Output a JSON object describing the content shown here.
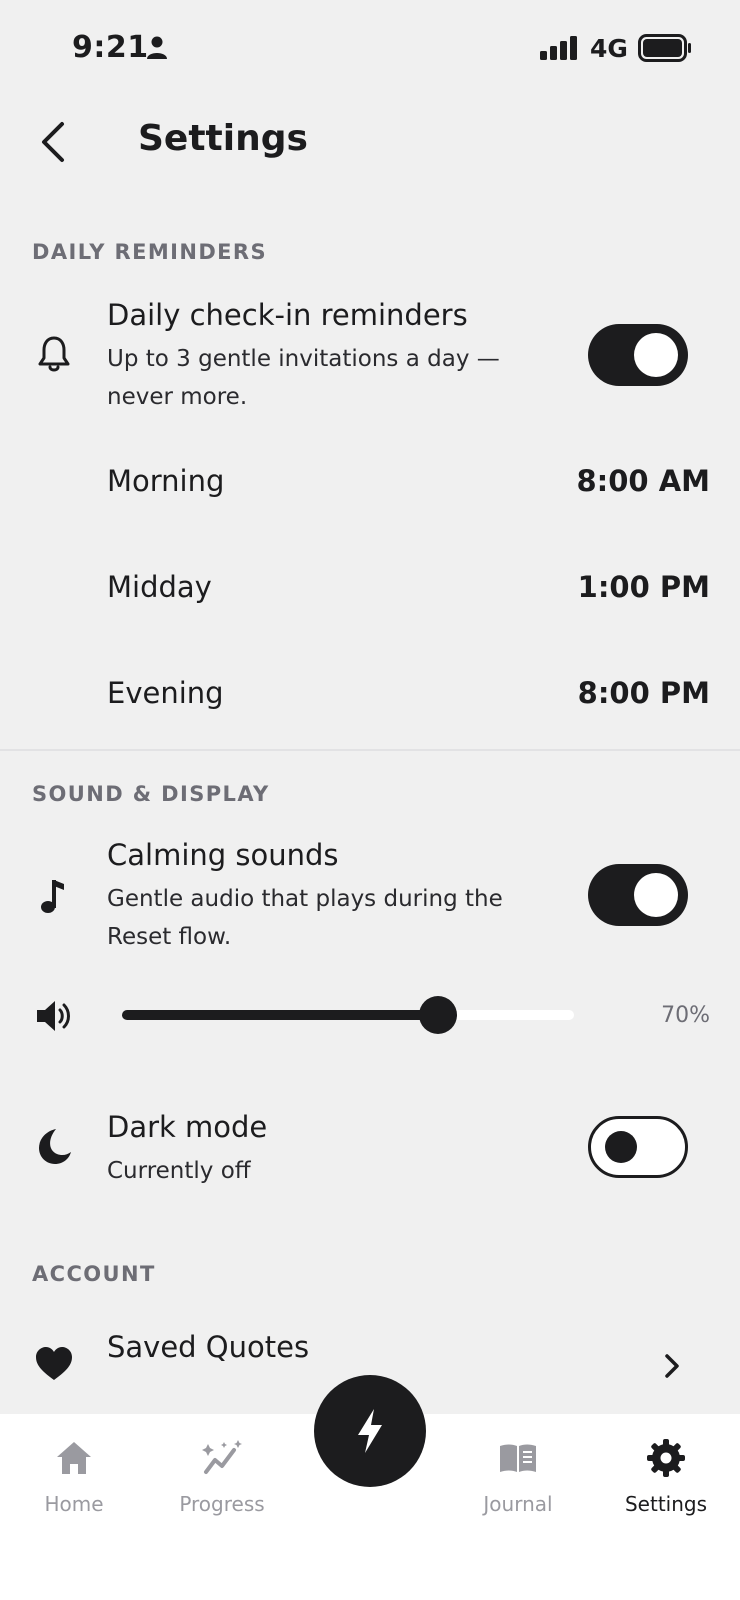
{
  "status_bar": {
    "time": "9:21",
    "network": "4G"
  },
  "header": {
    "title": "Settings"
  },
  "reminders": {
    "section_label": "DAILY REMINDERS",
    "title": "Daily check-in reminders",
    "subtitle": "Up to 3 gentle invitations a day — never more.",
    "enabled": true,
    "times": [
      {
        "label": "Morning",
        "value": "8:00 AM"
      },
      {
        "label": "Midday",
        "value": "1:00 PM"
      },
      {
        "label": "Evening",
        "value": "8:00 PM"
      }
    ]
  },
  "sound_display": {
    "section_label": "SOUND & DISPLAY",
    "calming_title": "Calming sounds",
    "calming_subtitle": "Gentle audio that plays during the Reset flow.",
    "calming_enabled": true,
    "volume_fraction": 0.7,
    "volume_text": "70%",
    "dark_mode_title": "Dark mode",
    "dark_mode_subtitle": "Currently off",
    "dark_mode_enabled": false
  },
  "account": {
    "section_label": "ACCOUNT",
    "saved_quotes": "Saved Quotes"
  },
  "nav": {
    "items": [
      {
        "label": "Home",
        "icon": "home-icon",
        "active": false
      },
      {
        "label": "Progress",
        "icon": "progress-icon",
        "active": false
      },
      {
        "label": "Journal",
        "icon": "journal-icon",
        "active": false
      },
      {
        "label": "Settings",
        "icon": "gear-icon",
        "active": true
      }
    ],
    "fab_icon": "lightning-icon"
  },
  "colors": {
    "accent": "#1c1c1e",
    "background": "#f0f0f0",
    "muted": "#6d6d75"
  }
}
